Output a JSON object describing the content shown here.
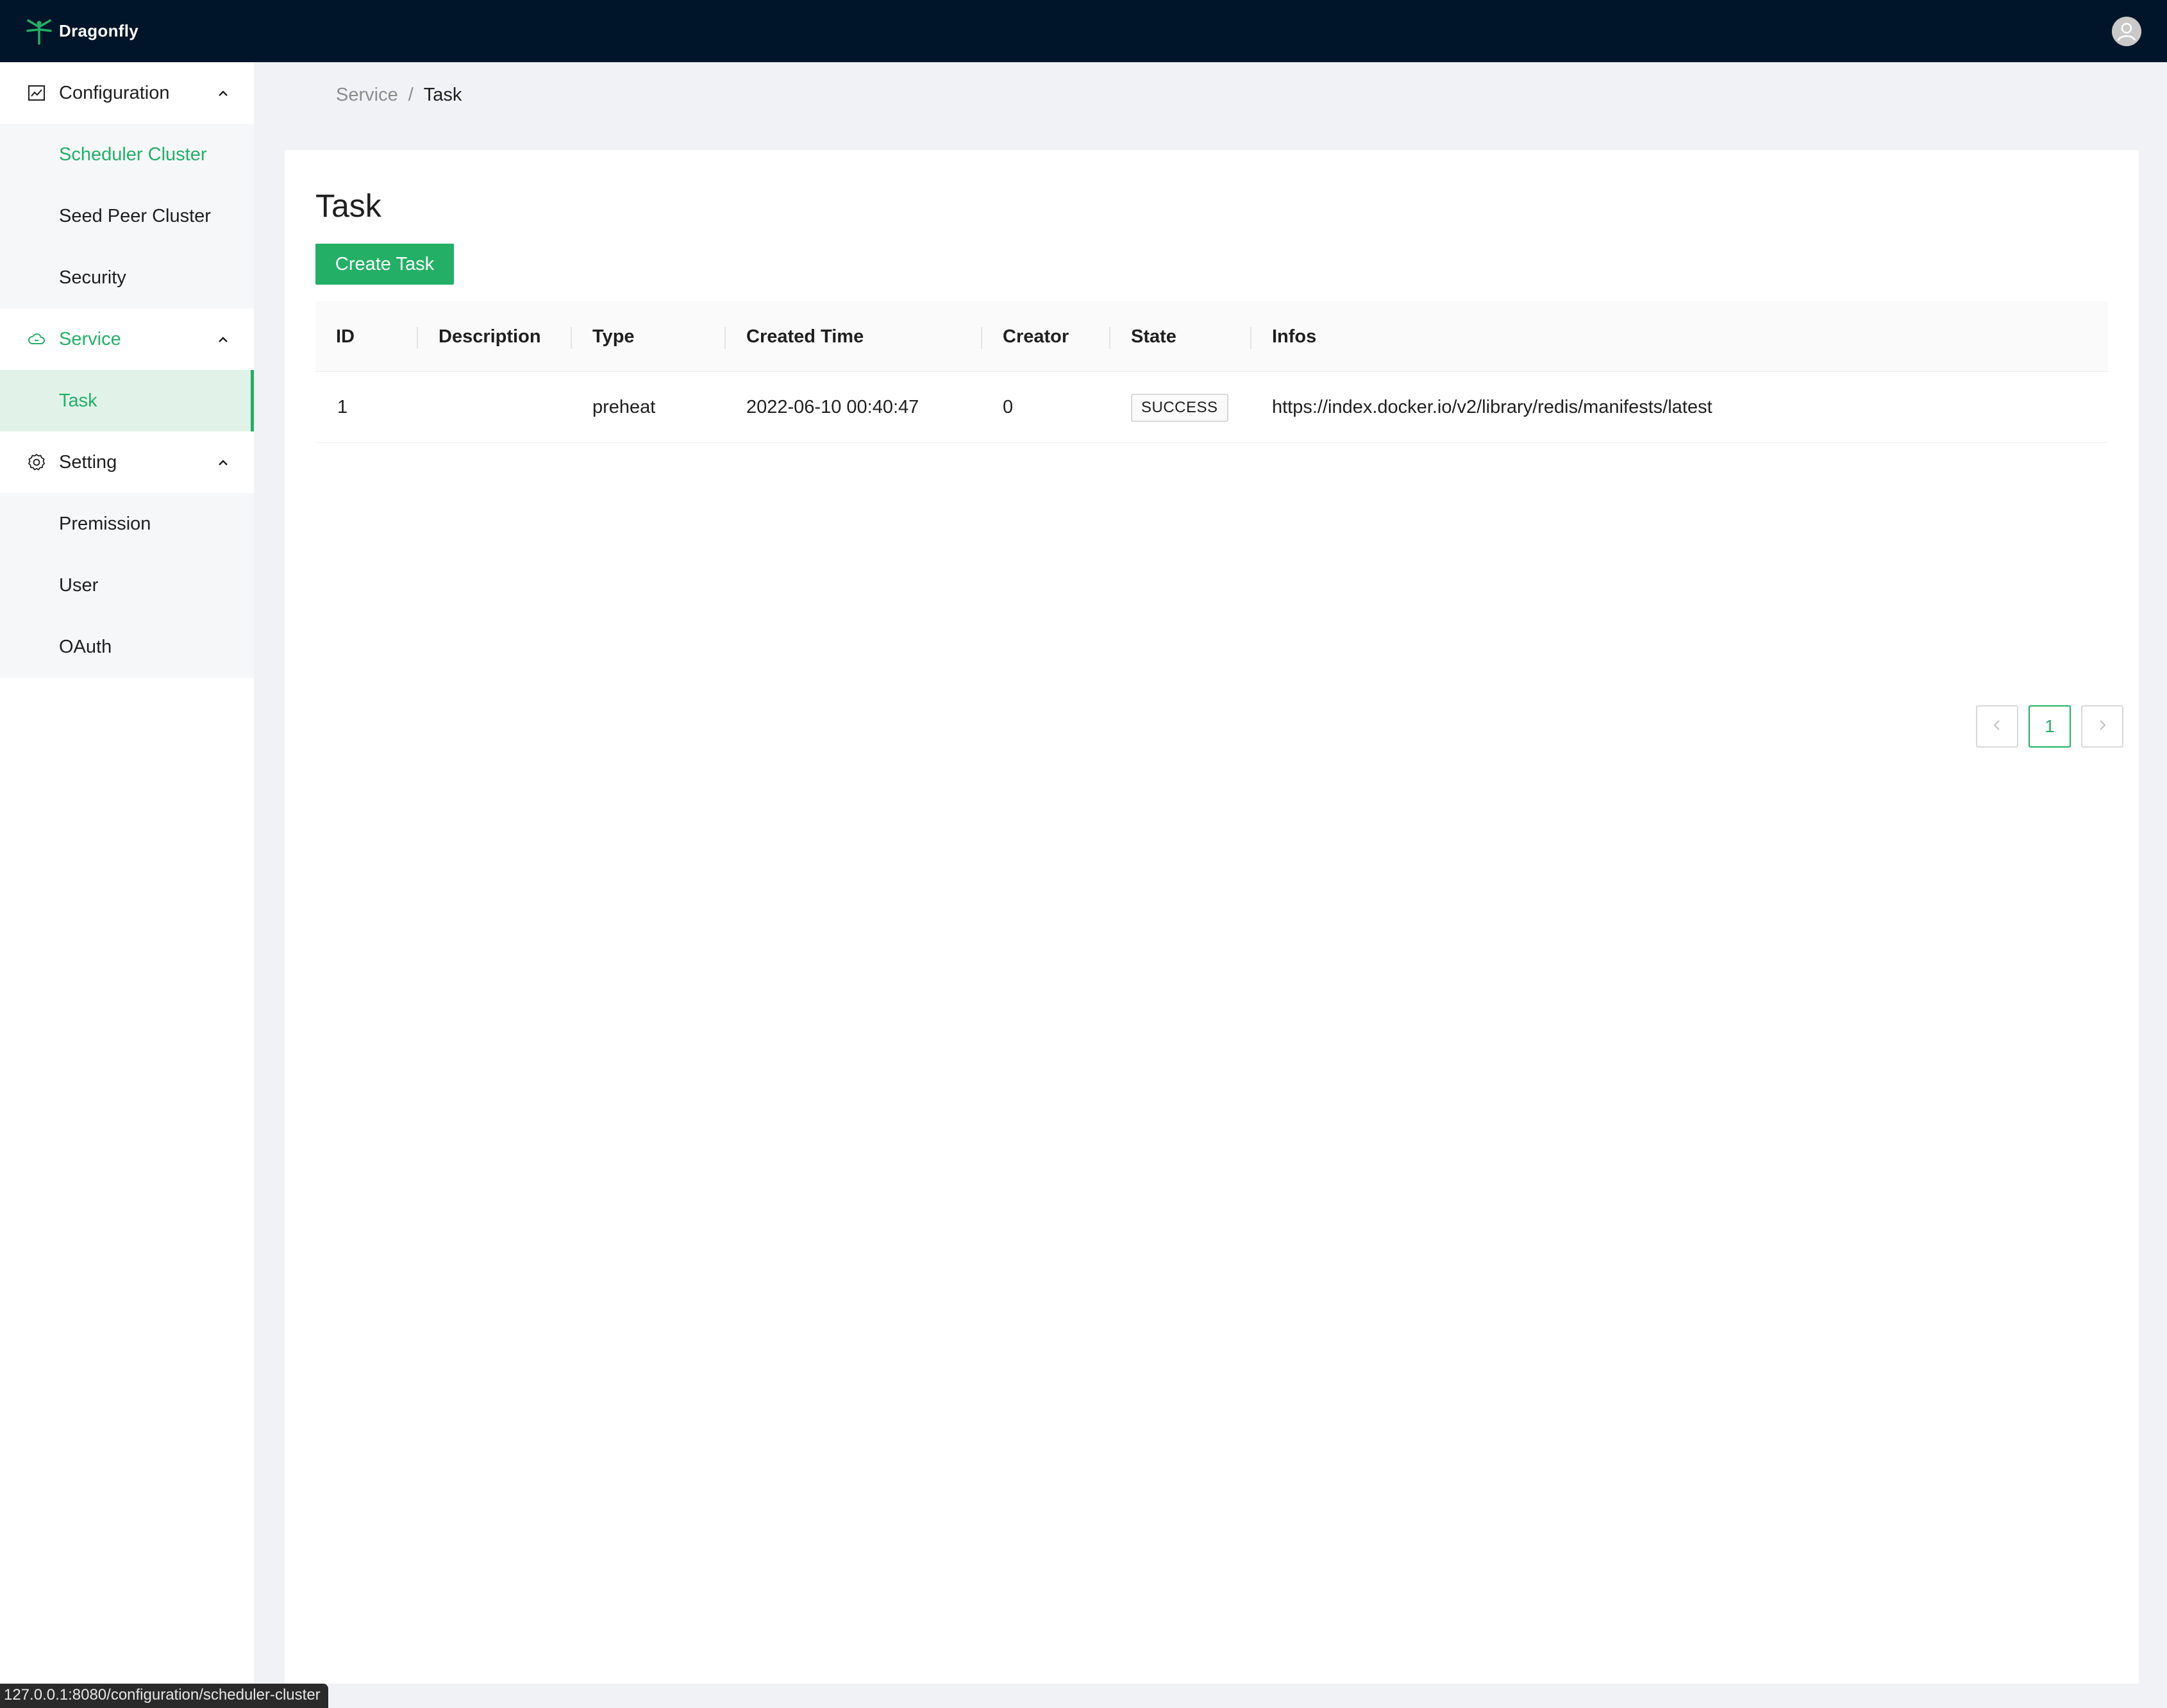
{
  "header": {
    "brand_name": "Dragonfly",
    "logo_icon": "dragonfly-logo-icon",
    "avatar_icon": "user-avatar-icon"
  },
  "sidebar": {
    "groups": [
      {
        "label": "Configuration",
        "icon": "chart-icon",
        "expanded": true,
        "items": [
          {
            "label": "Scheduler Cluster",
            "state": "highlighted"
          },
          {
            "label": "Seed Peer Cluster"
          },
          {
            "label": "Security"
          }
        ]
      },
      {
        "label": "Service",
        "icon": "cloud-icon",
        "expanded": true,
        "active": true,
        "items": [
          {
            "label": "Task",
            "state": "selected"
          }
        ]
      },
      {
        "label": "Setting",
        "icon": "gear-icon",
        "expanded": true,
        "items": [
          {
            "label": "Premission"
          },
          {
            "label": "User"
          },
          {
            "label": "OAuth"
          }
        ]
      }
    ]
  },
  "breadcrumb": {
    "parent": "Service",
    "separator": "/",
    "current": "Task"
  },
  "page": {
    "title": "Task",
    "create_button_label": "Create Task"
  },
  "table": {
    "columns": [
      "ID",
      "Description",
      "Type",
      "Created Time",
      "Creator",
      "State",
      "Infos"
    ],
    "rows": [
      {
        "id": "1",
        "description": "",
        "type": "preheat",
        "created_time": "2022-06-10 00:40:47",
        "creator": "0",
        "state": "SUCCESS",
        "infos": "https://index.docker.io/v2/library/redis/manifests/latest"
      }
    ]
  },
  "pagination": {
    "prev_icon": "chevron-left-icon",
    "current_page": "1",
    "next_icon": "chevron-right-icon"
  },
  "status_bar": {
    "url": "127.0.0.1:8080/configuration/scheduler-cluster"
  },
  "colors": {
    "accent": "#23b066",
    "header_bg": "#001529",
    "page_bg": "#f0f2f5"
  }
}
